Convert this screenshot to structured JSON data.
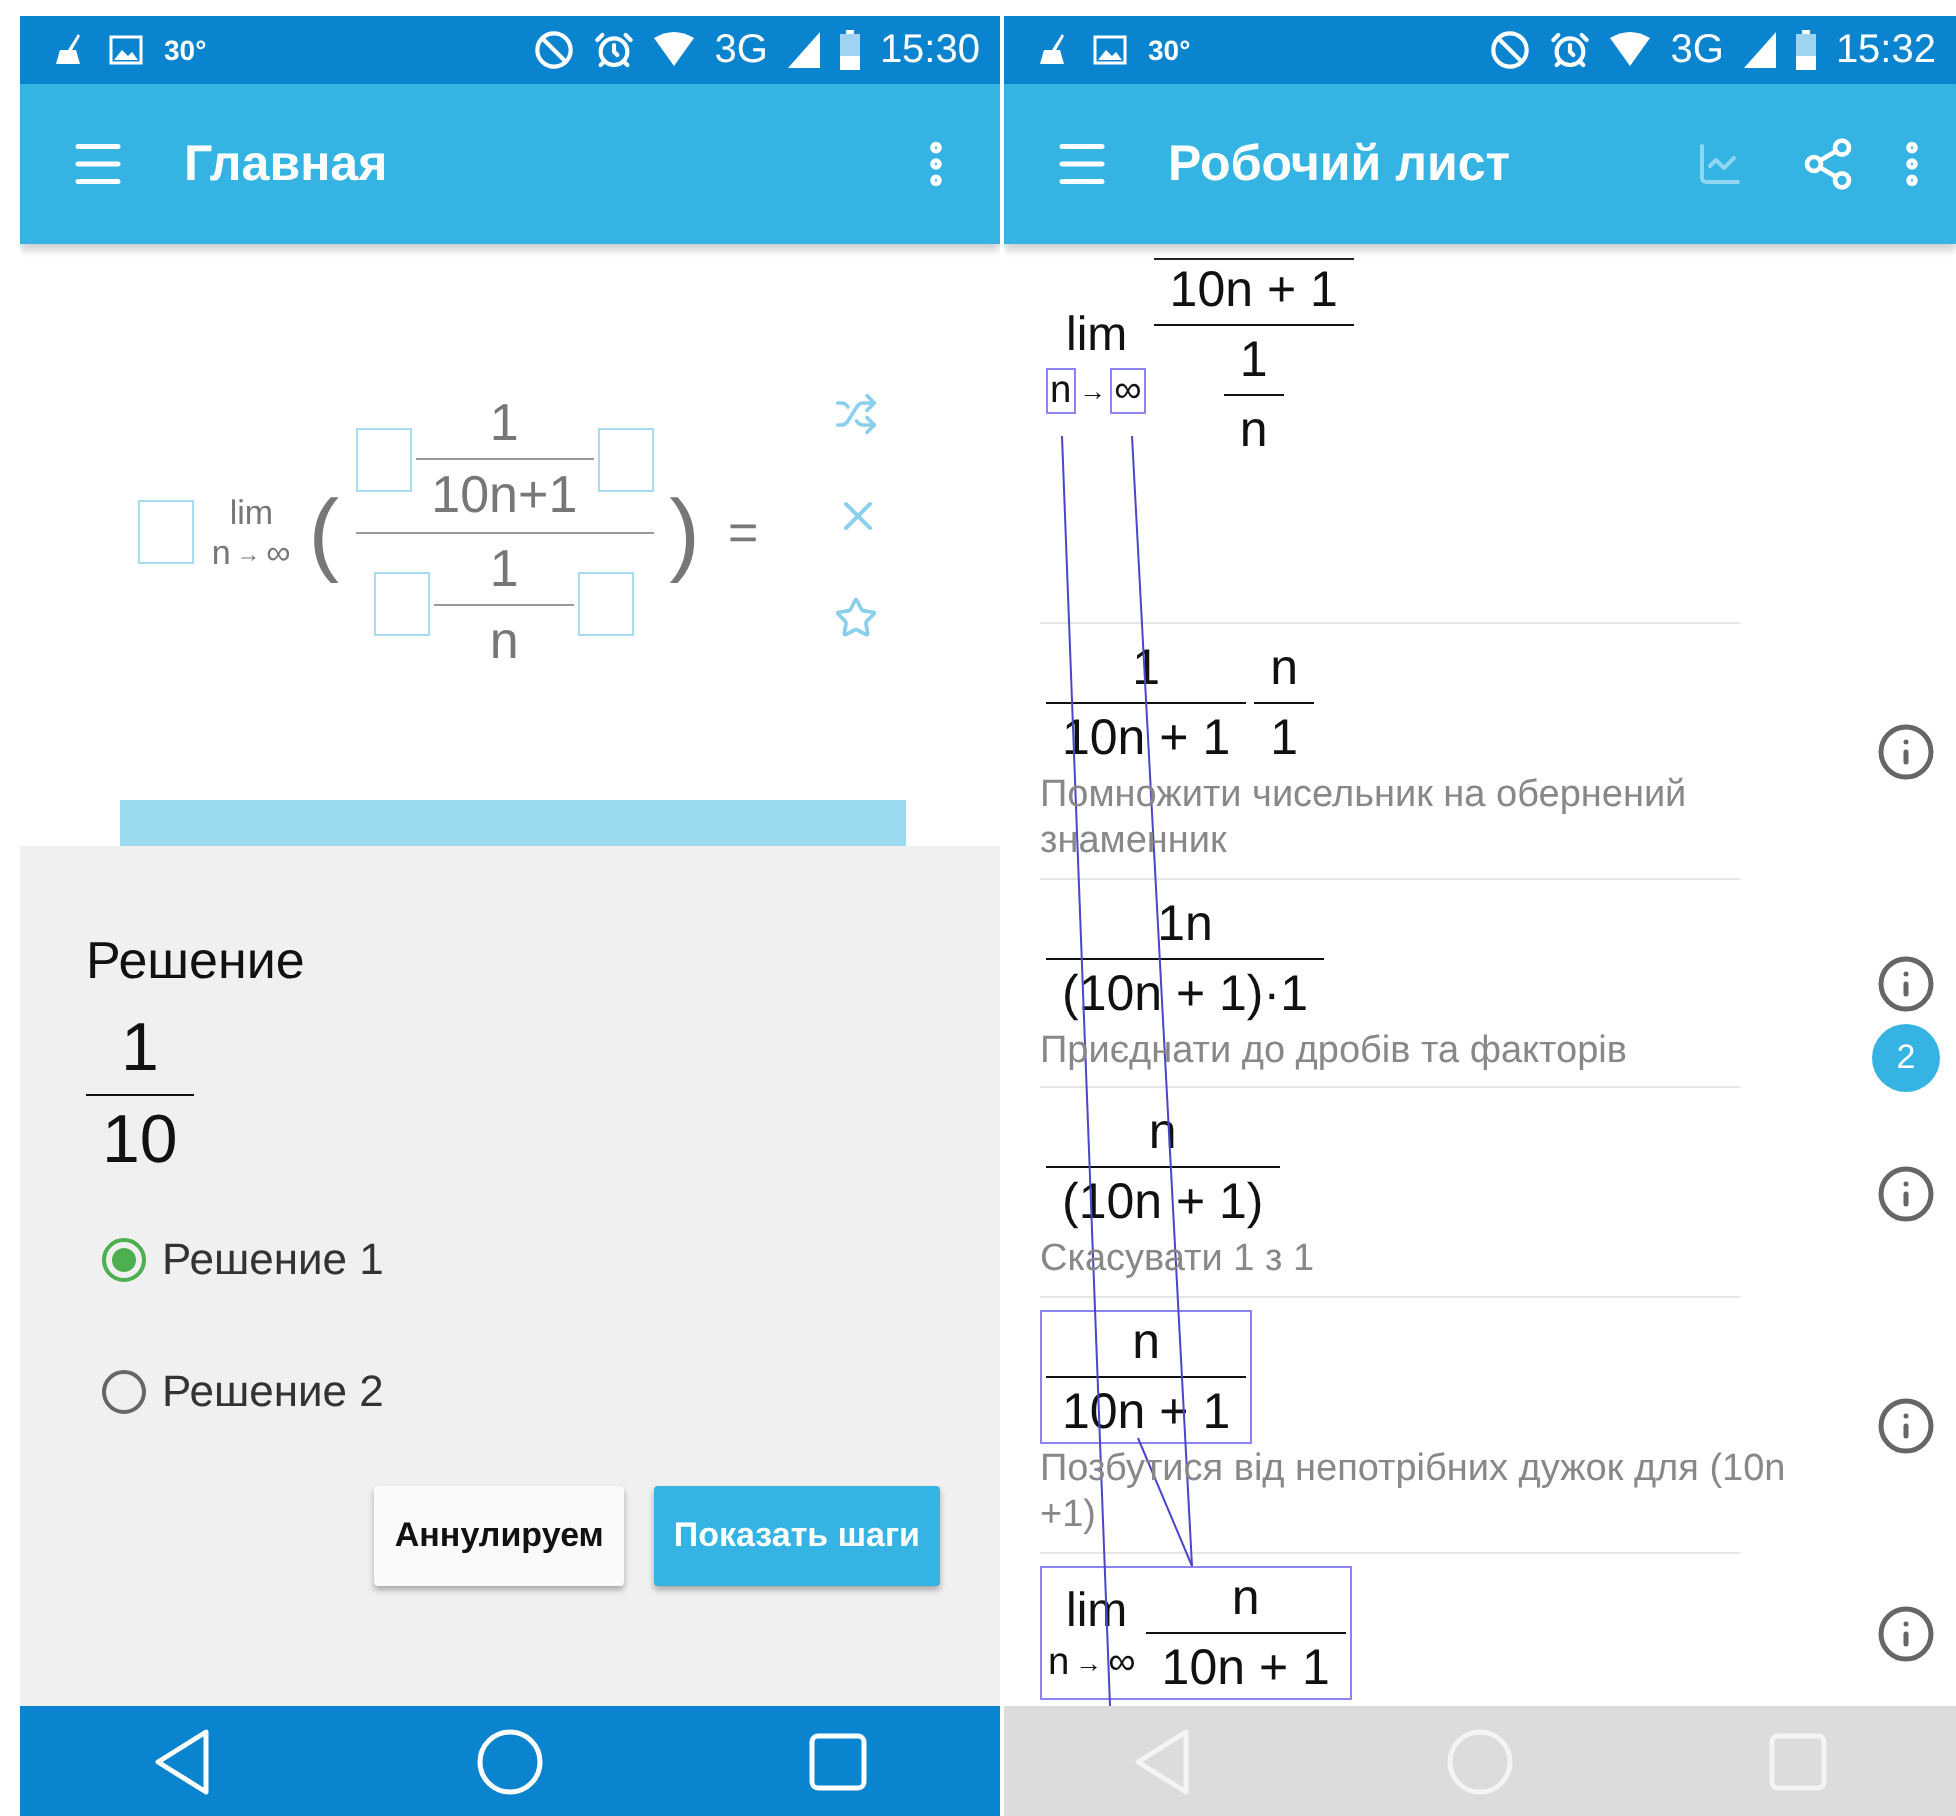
{
  "left_screen": {
    "status_bar": {
      "temperature": "30°",
      "network": "3G",
      "time": "15:30"
    },
    "app_bar": {
      "title": "Главная"
    },
    "expression": {
      "limit": {
        "word": "lim",
        "var": "n",
        "arrow": "→",
        "target": "∞"
      },
      "open_paren": "(",
      "close_paren": ")",
      "numerator": {
        "num": "1",
        "den": "10n+1"
      },
      "denominator": {
        "num": "1",
        "den": "n"
      },
      "equals": "="
    },
    "dialog": {
      "title": "Решение",
      "result": {
        "num": "1",
        "den": "10"
      },
      "options": [
        {
          "label": "Решение 1",
          "selected": true
        },
        {
          "label": "Решение 2",
          "selected": false
        }
      ],
      "buttons": [
        {
          "label": "Аннулируем",
          "kind": "secondary"
        },
        {
          "label": "Показать шаги",
          "kind": "primary"
        }
      ]
    }
  },
  "right_screen": {
    "status_bar": {
      "temperature": "30°",
      "network": "3G",
      "time": "15:32"
    },
    "app_bar": {
      "title": "Робочий лист"
    },
    "steps": [
      {
        "kind": "original",
        "boxed": false,
        "terms": [
          {
            "kind": "lim",
            "word": "lim",
            "var": "n",
            "arrow": "→",
            "target": "∞",
            "boxed": true
          },
          {
            "kind": "frac",
            "num": "10n + 1",
            "overline": true,
            "den": {
              "num": "1",
              "den": "n"
            }
          }
        ]
      },
      {
        "boxed": false,
        "terms": [
          {
            "kind": "frac",
            "num": "1",
            "den": "10n + 1"
          },
          {
            "kind": "frac",
            "num": "n",
            "den": "1"
          }
        ],
        "description": "Помножити чисельник на обернений знаменник",
        "kind": "step"
      },
      {
        "boxed": false,
        "terms": [
          {
            "kind": "frac",
            "num": "1n",
            "den": "(10n + 1)·1"
          }
        ],
        "description": "Приєднати до дробів та факторів",
        "kind": "step",
        "badge": "2"
      },
      {
        "boxed": false,
        "terms": [
          {
            "kind": "frac",
            "num": "n",
            "den": "(10n + 1)"
          }
        ],
        "description": "Скасувати 1 з 1",
        "kind": "step"
      },
      {
        "boxed": true,
        "terms": [
          {
            "kind": "frac",
            "num": "n",
            "den": "10n + 1"
          }
        ],
        "description": "Позбутися від непотрібних дужок для (10n +1)",
        "kind": "step"
      },
      {
        "boxed": true,
        "terms": [
          {
            "kind": "lim",
            "word": "lim",
            "var": "n",
            "arrow": "→",
            "target": "∞",
            "boxed": false
          },
          {
            "kind": "frac",
            "num": "n",
            "den": "10n + 1"
          }
        ],
        "kind": "step"
      }
    ]
  }
}
